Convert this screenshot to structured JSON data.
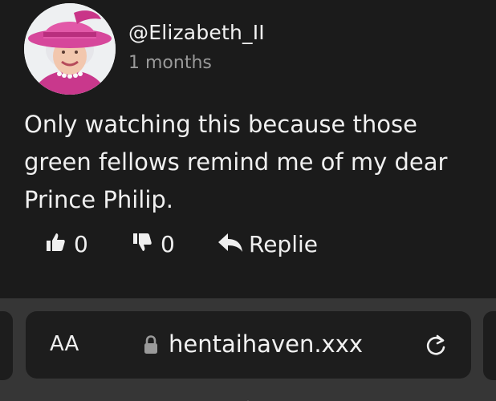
{
  "comment": {
    "username": "@Elizabeth_II",
    "time_ago": "1 months",
    "text": "Only watching this because those green fellows remind me of my dear Prince Philip.",
    "likes": "0",
    "dislikes": "0",
    "reply_label": "Replie",
    "icons": {
      "like": "thumbs-up-icon",
      "dislike": "thumbs-down-icon",
      "reply": "reply-arrow-icon"
    }
  },
  "browser": {
    "text_size_label": "AA",
    "url": "hentaihaven.xxx",
    "icons": {
      "lock": "lock-icon",
      "reload": "reload-icon"
    }
  },
  "colors": {
    "background": "#1b1b1b",
    "bar": "#363636",
    "urlbar": "#1d1d1d",
    "text": "#f0f0f0",
    "muted": "#9a9a9a",
    "hat": "#d6479b"
  }
}
